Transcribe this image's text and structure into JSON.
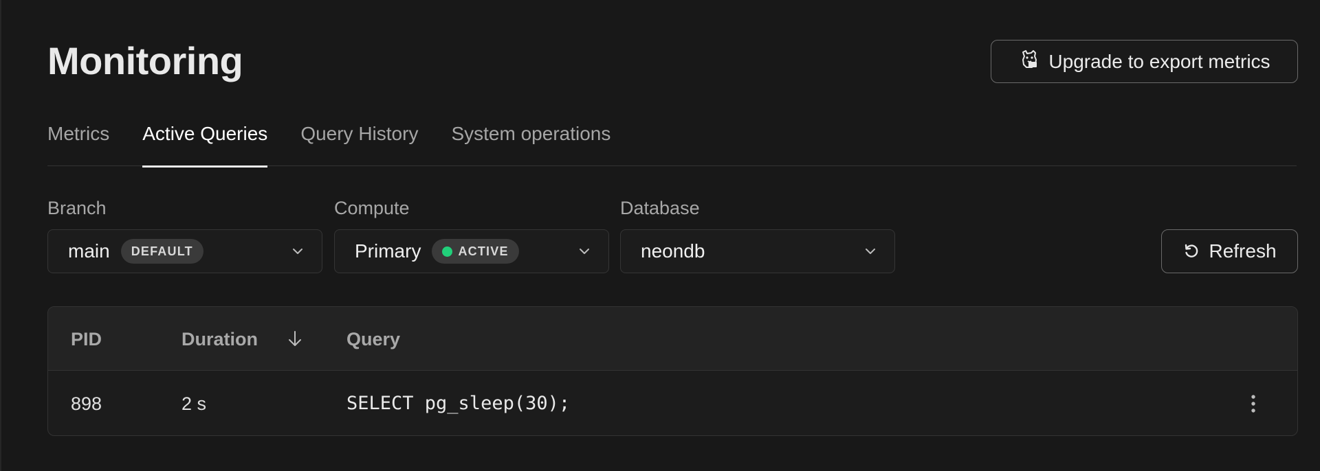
{
  "header": {
    "title": "Monitoring",
    "export_button": "Upgrade to export metrics",
    "export_icon": "datadog-dog-icon"
  },
  "tabs": [
    {
      "label": "Metrics",
      "active": false
    },
    {
      "label": "Active Queries",
      "active": true
    },
    {
      "label": "Query History",
      "active": false
    },
    {
      "label": "System operations",
      "active": false
    }
  ],
  "filters": {
    "branch": {
      "label": "Branch",
      "value": "main",
      "badge": "DEFAULT"
    },
    "compute": {
      "label": "Compute",
      "value": "Primary",
      "badge": "ACTIVE",
      "badge_dot_color": "#21d07a"
    },
    "database": {
      "label": "Database",
      "value": "neondb"
    }
  },
  "refresh_button": "Refresh",
  "table": {
    "columns": [
      "PID",
      "Duration",
      "Query"
    ],
    "sort": {
      "column": "Duration",
      "direction": "descending"
    },
    "rows": [
      {
        "pid": "898",
        "duration": "2 s",
        "query": "SELECT pg_sleep(30);"
      }
    ]
  }
}
